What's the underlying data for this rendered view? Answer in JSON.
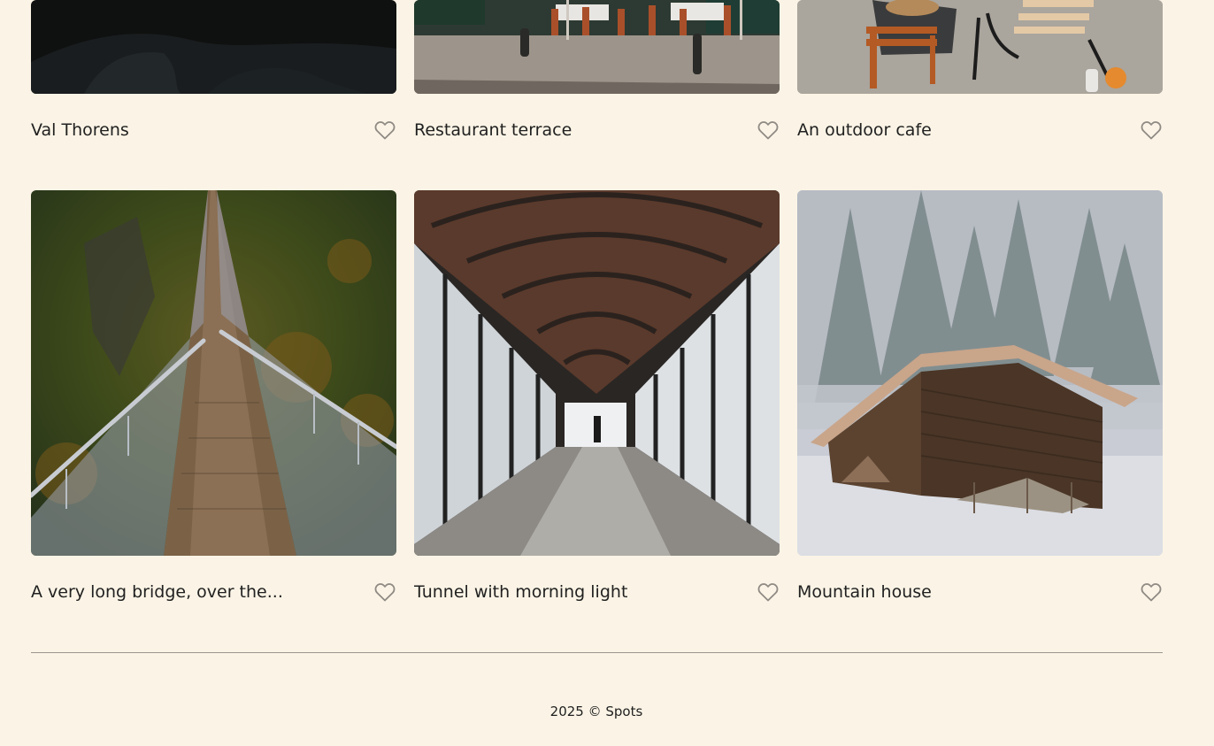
{
  "colors": {
    "background": "#fbf4e6",
    "text": "#212121",
    "heart_outline": "#8f8a84",
    "divider": "#9a968f"
  },
  "cards": [
    {
      "title": "Val Thorens",
      "image": "dark-bedroom-photo",
      "icon": "heart-icon"
    },
    {
      "title": "Restaurant terrace",
      "image": "restaurant-terrace-photo",
      "icon": "heart-icon"
    },
    {
      "title": "An outdoor cafe",
      "image": "outdoor-cafe-photo",
      "icon": "heart-icon"
    },
    {
      "title": "A very long bridge, over the...",
      "image": "suspension-bridge-photo",
      "icon": "heart-icon"
    },
    {
      "title": "Tunnel with morning light",
      "image": "glass-tunnel-photo",
      "icon": "heart-icon"
    },
    {
      "title": "Mountain house",
      "image": "snowy-cabin-photo",
      "icon": "heart-icon"
    }
  ],
  "footer": {
    "copyright": "2025 © Spots"
  }
}
